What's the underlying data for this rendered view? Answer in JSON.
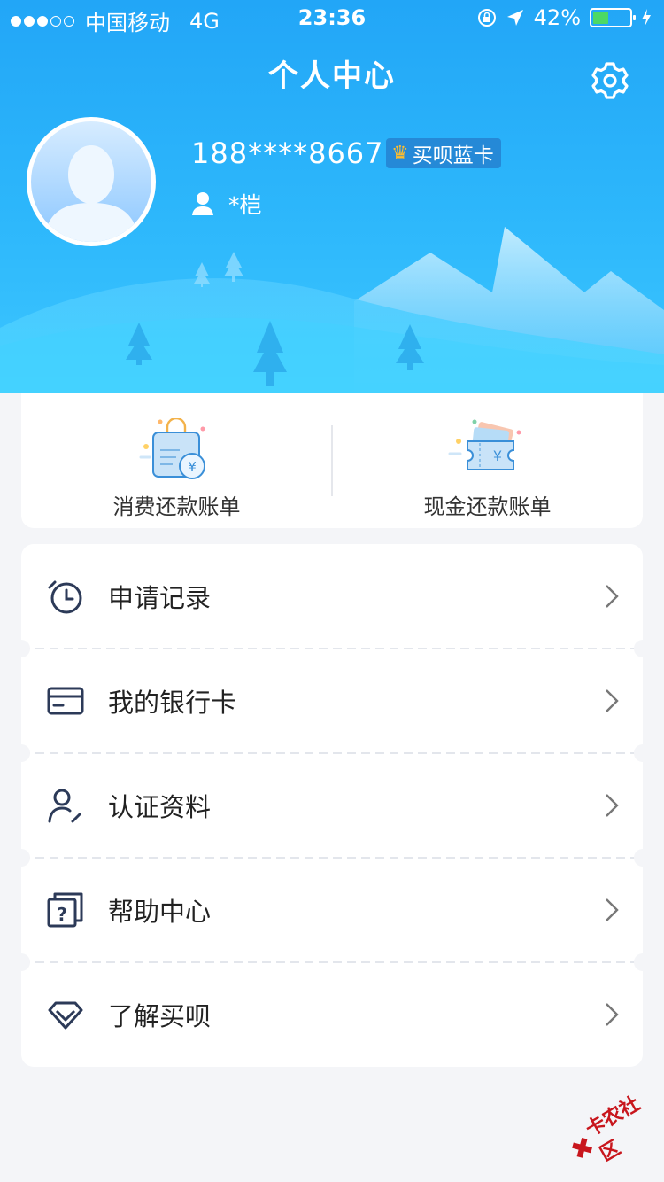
{
  "status_bar": {
    "carrier": "中国移动",
    "network": "4G",
    "time": "23:36",
    "battery": "42%",
    "battery_level": 0.42,
    "signal_dots_filled": 3,
    "signal_dots_total": 5
  },
  "header": {
    "title": "个人中心",
    "settings_icon": "gear-icon"
  },
  "profile": {
    "phone": "188****8667",
    "vip_badge": "买呗蓝卡",
    "name": "*桤"
  },
  "bills": [
    {
      "label": "消费还款账单",
      "icon": "shopping-bill-icon"
    },
    {
      "label": "现金还款账单",
      "icon": "cash-bill-icon"
    }
  ],
  "menu": [
    {
      "label": "申请记录",
      "icon": "clock-history-icon"
    },
    {
      "label": "我的银行卡",
      "icon": "bank-card-icon"
    },
    {
      "label": "认证资料",
      "icon": "user-verify-icon"
    },
    {
      "label": "帮助中心",
      "icon": "help-icon"
    },
    {
      "label": "了解买呗",
      "icon": "diamond-icon"
    }
  ],
  "watermark": "卡农社区",
  "colors": {
    "header_top": "#22a6f7",
    "header_bottom": "#3cc6ff",
    "icon_navy": "#2c3a58",
    "battery_green": "#4cd964",
    "crown_gold": "#ffbe2e"
  }
}
